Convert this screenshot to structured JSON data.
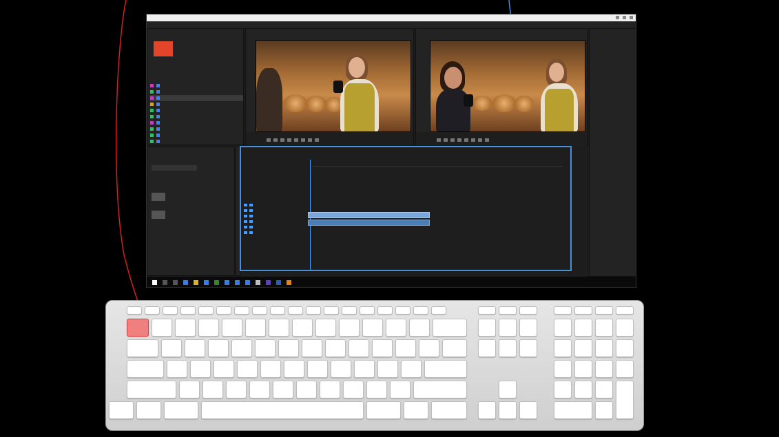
{
  "window": {
    "title": ""
  },
  "menu": {
    "items": [
      "",
      "",
      "",
      "",
      "",
      "",
      "",
      "",
      "",
      ""
    ]
  },
  "colors": {
    "callout_red": "#d42020",
    "callout_blue": "#4a90d9",
    "highlight_key": "#f08080",
    "app_bg": "#1d1d1d"
  },
  "project_panel": {
    "title": "",
    "clip_color": "#e2452a"
  },
  "source_monitor": {
    "timecode": ""
  },
  "program_monitor": {
    "timecode": ""
  },
  "timeline": {
    "title": "",
    "timecode": ""
  },
  "keyboard": {
    "highlighted_key": "esc",
    "highlighted_key_label": ""
  }
}
